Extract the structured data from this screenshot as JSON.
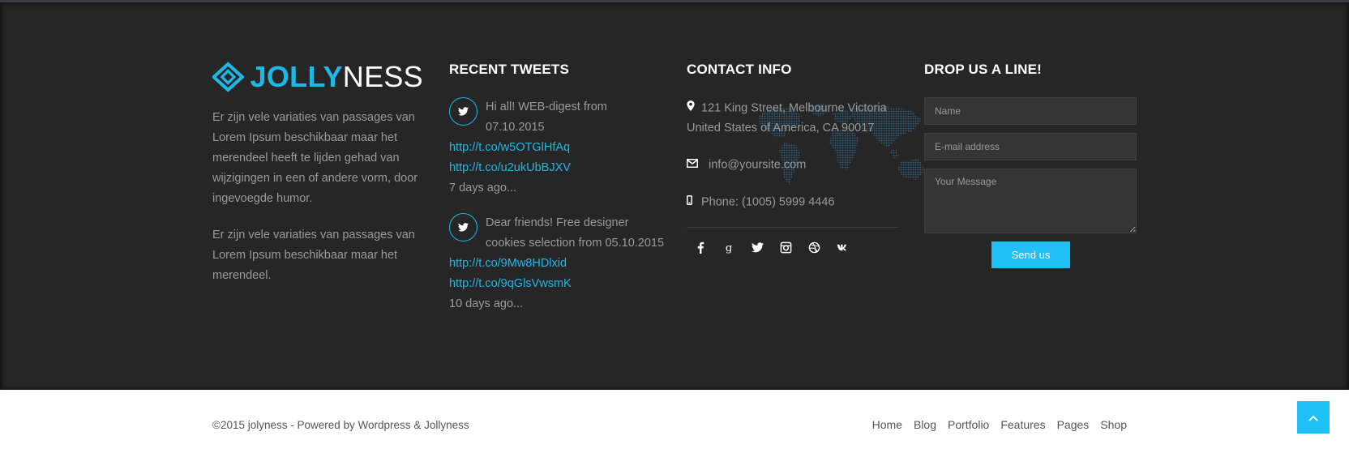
{
  "brand": {
    "name_bold": "JOLLY",
    "name_thin": "NESS",
    "accent": "#1fb7e6"
  },
  "about": {
    "paragraph_1": "Er zijn vele variaties van passages van Lorem Ipsum beschikbaar maar het merendeel heeft te lijden gehad van wijzigingen in een of andere vorm, door ingevoegde humor.",
    "paragraph_2": "Er zijn vele variaties van passages van Lorem Ipsum beschikbaar maar het merendeel."
  },
  "tweets": {
    "title": "RECENT TWEETS",
    "items": [
      {
        "text": "Hi all! WEB-digest from 07.10.2015",
        "links": [
          "http://t.co/w5OTGlHfAq",
          "http://t.co/u2ukUbBJXV"
        ],
        "time": "7 days ago..."
      },
      {
        "text": "Dear friends! Free designer cookies selection from 05.10.2015",
        "links": [
          "http://t.co/9Mw8HDlxid",
          "http://t.co/9qGlsVwsmK"
        ],
        "time": "10 days ago..."
      }
    ]
  },
  "contact": {
    "title": "CONTACT INFO",
    "address": "121 King Street, Melbourne Victoria United States of America, CA 90017",
    "email": "info@yoursite.com",
    "phone": "Phone: (1005) 5999 4446",
    "socials": [
      "facebook-icon",
      "google-plus-icon",
      "twitter-icon",
      "instagram-icon",
      "dribbble-icon",
      "vk-icon"
    ]
  },
  "form": {
    "title": "DROP US A LINE!",
    "name_placeholder": "Name",
    "email_placeholder": "E-mail address",
    "message_placeholder": "Your Message",
    "send_label": "Send us"
  },
  "footer": {
    "copyright": "©2015 jolyness - Powered by Wordpress & Jollyness",
    "nav": [
      "Home",
      "Blog",
      "Portfolio",
      "Features",
      "Pages",
      "Shop"
    ]
  }
}
